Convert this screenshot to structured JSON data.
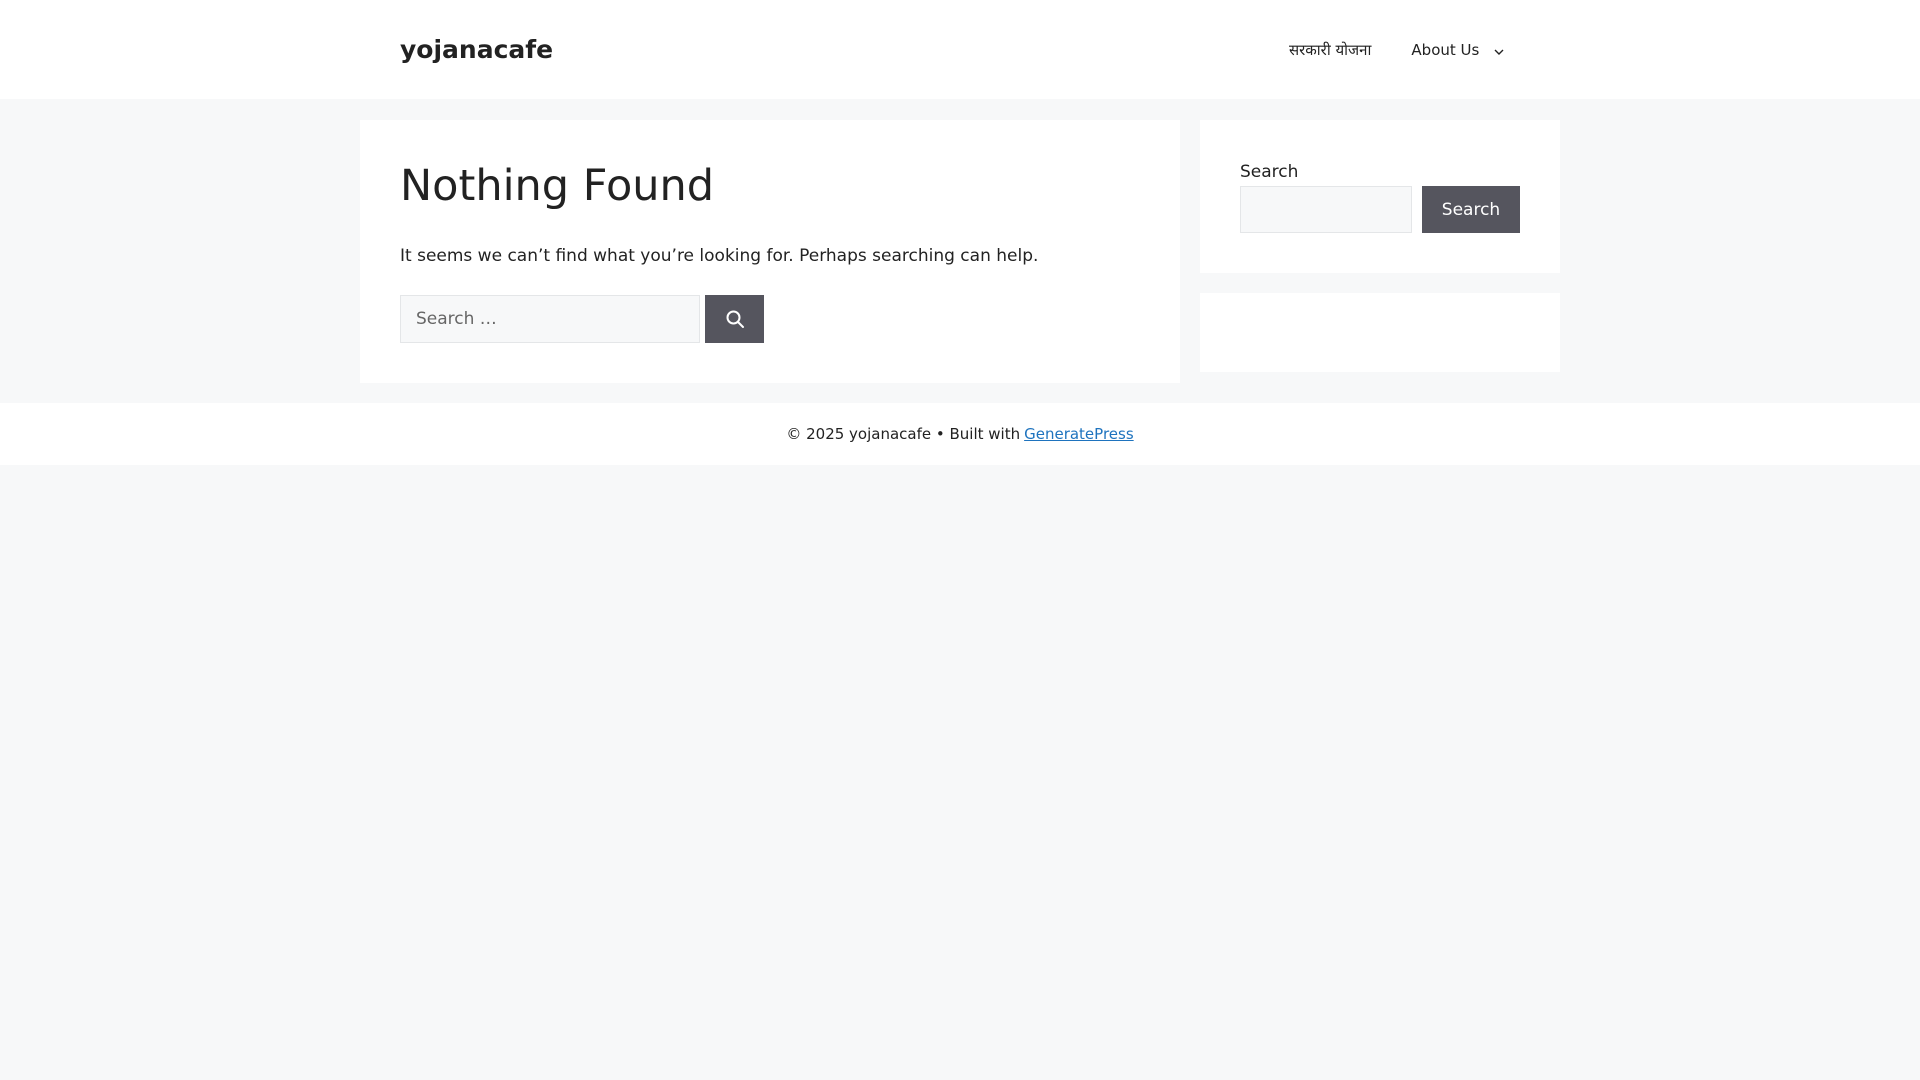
{
  "header": {
    "site_title": "yojanacafe",
    "nav": {
      "items": [
        {
          "label": "सरकारी योजना"
        },
        {
          "label": "About Us",
          "icon": "chevron-down-icon"
        }
      ]
    }
  },
  "main": {
    "title": "Nothing Found",
    "text": "It seems we can’t find what you’re looking for. Perhaps searching can help.",
    "search": {
      "placeholder": "Search …",
      "value": "",
      "submit_icon": "search-icon"
    }
  },
  "sidebar": {
    "search_widget": {
      "label": "Search",
      "input_value": "",
      "button_label": "Search"
    }
  },
  "footer": {
    "copyright": "© 2025 yojanacafe • Built with",
    "link_text": "GeneratePress"
  },
  "colors": {
    "page_background": "#f7f8f9",
    "surface": "#ffffff",
    "button": "#55555e",
    "link": "#1e73be",
    "text": "#222222"
  }
}
